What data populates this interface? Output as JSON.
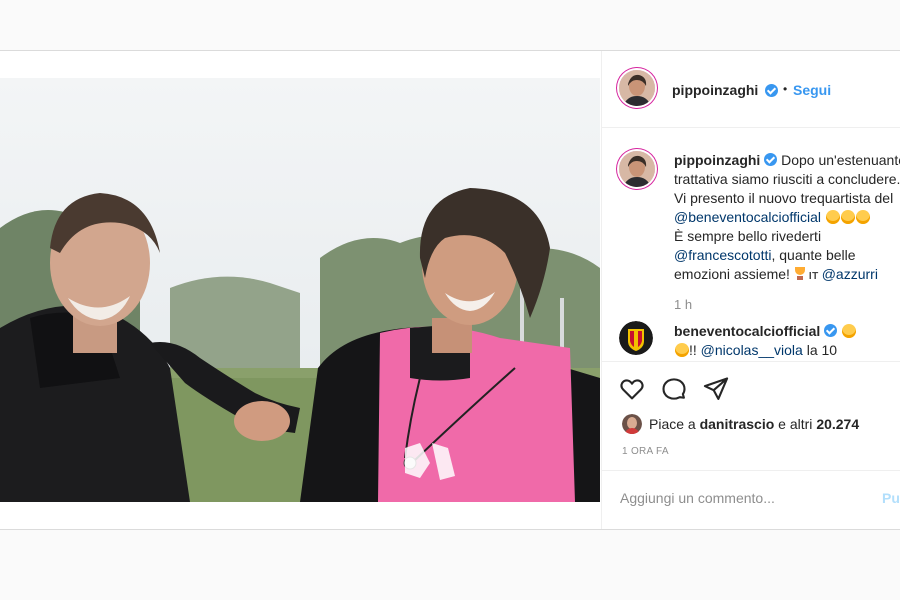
{
  "post": {
    "author": "pippoinzaghi",
    "follow_separator": "•",
    "follow_label": "Segui",
    "caption_parts": {
      "p1": "Dopo un'estenuante trattativa siamo riusciti a concludere. Vi presento il nuovo trequartista del",
      "mention1": "@beneventocalciofficial",
      "p2": "È sempre bello rivederti",
      "mention2": "@francescototti",
      "p3": ", quante belle emozioni assieme!",
      "flag": "IT",
      "mention3": "@azzurri"
    },
    "caption_time": "1 h",
    "comment": {
      "author": "beneventocalciofficial",
      "text_prefix": "!! ",
      "mention": "@nicolas__viola",
      "text_suffix": " la 10"
    },
    "likes": {
      "prefix": "Piace a ",
      "user": "danitrascio",
      "middle": " e altri ",
      "count": "20.274"
    },
    "timestamp": "1 ORA FA",
    "add_comment_placeholder": "Aggiungi un commento...",
    "publish_label": "Pubblica"
  },
  "colors": {
    "accent": "#3897f0",
    "mention": "#00376b",
    "secondary_text": "#8e8e8e",
    "vest_pink": "#f06aa9"
  },
  "icons": [
    "verified-badge-icon",
    "heart-icon",
    "comment-icon",
    "share-icon",
    "smile-emoji-icon",
    "trophy-icon"
  ]
}
